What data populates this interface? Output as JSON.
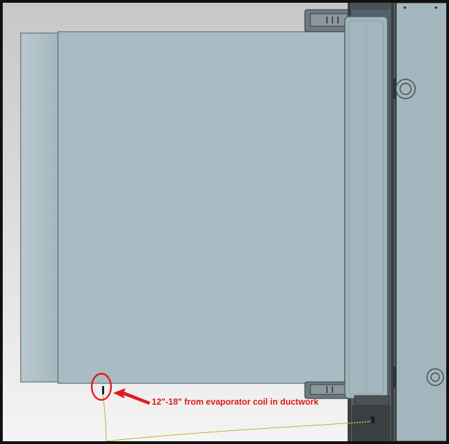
{
  "annotation": {
    "label": "12\"-18\" from evaporator coil in ductwork"
  },
  "colors": {
    "background_top": "#c7c7c7",
    "background_bottom": "#f4f4f4",
    "duct_fill": "#a9bcc3",
    "duct_edge": "#5f6f75",
    "furnace_fill": "#a3b6bd",
    "furnace_edge": "#4f5d62",
    "dark_metal": "#3a3f42",
    "annotation_red": "#e01b1b",
    "sensor_wire": "#e8e04a"
  },
  "icons": [
    "ring-icon",
    "arrow-icon",
    "sensor-probe-icon"
  ]
}
